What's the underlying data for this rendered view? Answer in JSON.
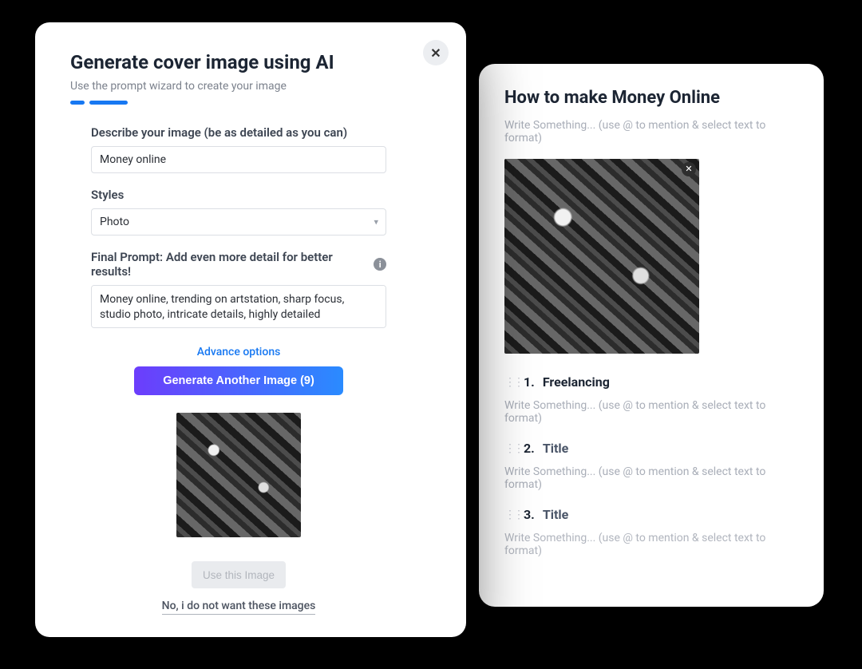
{
  "modal": {
    "close_glyph": "✕",
    "title": "Generate cover image using AI",
    "subtitle": "Use the prompt wizard to create your image",
    "describe_label": "Describe your image (be as detailed as you can)",
    "describe_value": "Money online",
    "styles_label": "Styles",
    "styles_value": "Photo",
    "final_prompt_label": "Final Prompt: Add even more detail for better results!",
    "final_prompt_value": "Money online, trending on artstation, sharp focus, studio photo, intricate details, highly detailed",
    "advance_link": "Advance options",
    "generate_button": "Generate Another Image (9)",
    "use_button": "Use this Image",
    "reject_link": "No, i do not want these images"
  },
  "editor": {
    "title": "How to make Money Online",
    "placeholder": "Write Something... (use @ to mention & select text to format)",
    "cover_remove_glyph": "✕",
    "items": [
      {
        "num": "1.",
        "title": "Freelancing",
        "dark": true
      },
      {
        "num": "2.",
        "title": "Title",
        "dark": false
      },
      {
        "num": "3.",
        "title": "Title",
        "dark": false
      }
    ]
  }
}
